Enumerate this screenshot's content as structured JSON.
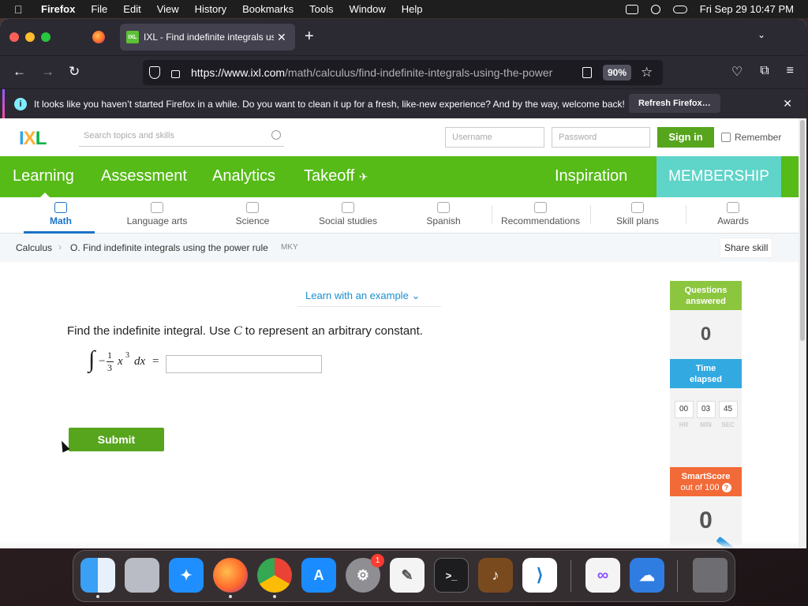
{
  "menubar": {
    "app_name": "Firefox",
    "menus": [
      "File",
      "Edit",
      "View",
      "History",
      "Bookmarks",
      "Tools",
      "Window",
      "Help"
    ],
    "clock": "Fri Sep 29  10:47 PM"
  },
  "browser": {
    "tab_title": "IXL - Find indefinite integrals us",
    "tab_favicon_text": "IXL",
    "url_host": "https://www.ixl.com",
    "url_path": "/math/calculus/find-indefinite-integrals-using-the-power",
    "zoom": "90%",
    "notification": "It looks like you haven’t started Firefox in a while. Do you want to clean it up for a fresh, like-new experience? And by the way, welcome back!",
    "notification_button": "Refresh Firefox…"
  },
  "header": {
    "logo": {
      "i": "I",
      "x": "X",
      "l": "L"
    },
    "search_placeholder": "Search topics and skills",
    "username_placeholder": "Username",
    "password_placeholder": "Password",
    "sign_in": "Sign in",
    "remember": "Remember"
  },
  "mainnav": {
    "learning": "Learning",
    "assessment": "Assessment",
    "analytics": "Analytics",
    "takeoff": "Takeoff",
    "inspiration": "Inspiration",
    "membership": "MEMBERSHIP"
  },
  "subnav": {
    "math": "Math",
    "language_arts": "Language arts",
    "science": "Science",
    "social_studies": "Social studies",
    "spanish": "Spanish",
    "recommendations": "Recommendations",
    "skill_plans": "Skill plans",
    "awards": "Awards"
  },
  "breadcrumb": {
    "subject": "Calculus",
    "skill": "O. Find indefinite integrals using the power rule",
    "code": "MKY",
    "share": "Share skill"
  },
  "practice": {
    "learn_example": "Learn with an example",
    "question_prefix": "Find the indefinite integral. Use ",
    "question_var": "C",
    "question_suffix": " to represent an arbitrary constant.",
    "integral_sign": "∫",
    "neg": "−",
    "numerator": "1",
    "denominator": "3",
    "variable": "x",
    "exponent": "3",
    "differential": "dx",
    "equals": "=",
    "answer_value": "",
    "submit": "Submit"
  },
  "stats": {
    "questions_label_1": "Questions",
    "questions_label_2": "answered",
    "questions_value": "0",
    "time_label_1": "Time",
    "time_label_2": "elapsed",
    "hr": "00",
    "min": "03",
    "sec": "45",
    "hr_label": "HR",
    "min_label": "MIN",
    "sec_label": "SEC",
    "smartscore_label": "SmartScore",
    "smartscore_sub": "out of 100",
    "smartscore_value": "0"
  },
  "dock": {
    "settings_badge": "1",
    "terminal_glyph": ">_"
  },
  "colors": {
    "ixl_green": "#56ba17",
    "membership_teal": "#5fd4c9",
    "questions_green": "#8cc63e",
    "time_blue": "#32a9e1",
    "smartscore_orange": "#f26a37",
    "link_blue": "#1a8fd1"
  }
}
